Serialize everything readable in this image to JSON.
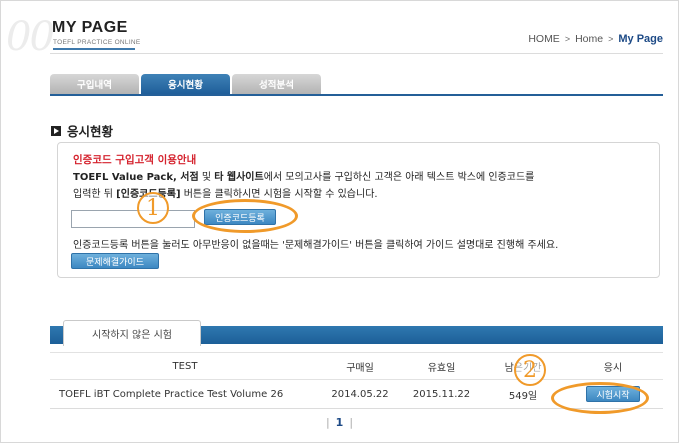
{
  "header": {
    "bg_number": "00",
    "title": "MY PAGE",
    "subtitle": "TOEFL PRACTICE ONLINE",
    "breadcrumb": [
      "HOME",
      "Home",
      "My Page"
    ]
  },
  "tabs": [
    {
      "label": "구입내역",
      "active": false
    },
    {
      "label": "응시현황",
      "active": true
    },
    {
      "label": "성적분석",
      "active": false
    }
  ],
  "section_title": "응시현황",
  "notice": {
    "title": "인증코드 구입고객 이용안내",
    "line1_bold_a": "TOEFL Value Pack, 서점",
    "line1_mid": " 및 ",
    "line1_bold_b": "타 웹사이트",
    "line1_rest": "에서 모의고사를 구입하신 고객은 아래 텍스트 박스에 인증코드를",
    "line2_a": "입력한 뒤 ",
    "line2_bold": "[인증코드등록]",
    "line2_b": " 버튼을 클릭하시면 시험을 시작할 수 있습니다.",
    "input_value": "",
    "register_button": "인증코드등록",
    "line3": "인증코드등록 버튼을 눌러도 아무반응이 없을때는 '문제해결가이드' 버튼을 클릭하여 가이드 설명대로 진행해 주세요.",
    "trouble_button": "문제해결가이드"
  },
  "annotations": {
    "one": "1",
    "two": "2"
  },
  "tests_tab": "시작하지 않은 시험",
  "table": {
    "headers": [
      "TEST",
      "구매일",
      "유효일",
      "남은기간",
      "응시"
    ],
    "rows": [
      {
        "test": "TOEFL iBT Complete Practice Test Volume 26",
        "purchase": "2014.05.22",
        "valid": "2015.11.22",
        "remaining": "549일",
        "action": "시험시작"
      }
    ]
  },
  "pagination": {
    "current": "1"
  },
  "colors": {
    "accent": "#245f98",
    "notice_title": "#d5232e",
    "annotation": "#f09a2a"
  }
}
